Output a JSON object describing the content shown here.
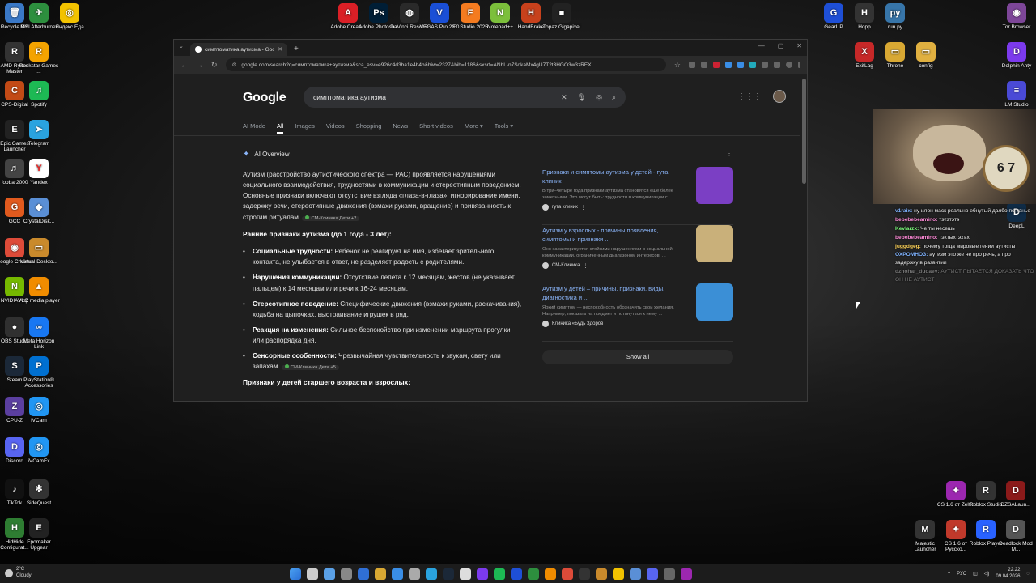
{
  "desktop": {
    "icons_left": [
      {
        "label": "Recycle Bin",
        "color": "#3a78c6",
        "glyph": "🗑"
      },
      {
        "label": "MSI Afterburner",
        "color": "#2d8f3e",
        "glyph": "✈"
      },
      {
        "label": "Яндекс.Еда",
        "color": "#f2c200",
        "glyph": "◎"
      },
      {
        "label": "AMD Ryzen Master",
        "color": "#333333",
        "glyph": "R"
      },
      {
        "label": "Rockstar Games ...",
        "color": "#f4a300",
        "glyph": "R"
      },
      {
        "label": "CPS-Digital",
        "color": "#c24a16",
        "glyph": "C"
      },
      {
        "label": "Spotify",
        "color": "#1db954",
        "glyph": "♫"
      },
      {
        "label": "Epic Games Launcher",
        "color": "#222222",
        "glyph": "E"
      },
      {
        "label": "Telegram",
        "color": "#2aa3df",
        "glyph": "➤"
      },
      {
        "label": "foobar2000",
        "color": "#444444",
        "glyph": "♬"
      },
      {
        "label": "Yandex",
        "color": "#ffffff",
        "glyph": "Y"
      },
      {
        "label": "GCC",
        "color": "#e15a1e",
        "glyph": "G"
      },
      {
        "label": "CrystalDisk...",
        "color": "#5a8fd6",
        "glyph": "◆"
      },
      {
        "label": "Google Chrome",
        "color": "#dd4b39",
        "glyph": "◉"
      },
      {
        "label": "Virtual Deskto...",
        "color": "#c98a2c",
        "glyph": "▭"
      },
      {
        "label": "NVIDIA App",
        "color": "#76b900",
        "glyph": "N"
      },
      {
        "label": "VLC media player",
        "color": "#f08c00",
        "glyph": "▲"
      },
      {
        "label": "OBS Studio",
        "color": "#303030",
        "glyph": "●"
      },
      {
        "label": "Meta Horizon Link",
        "color": "#1877f2",
        "glyph": "∞"
      },
      {
        "label": "Steam",
        "color": "#1b2838",
        "glyph": "S"
      },
      {
        "label": "PlayStation® Accessories",
        "color": "#0070d1",
        "glyph": "P"
      },
      {
        "label": "CPU-Z",
        "color": "#5b3fa0",
        "glyph": "Z"
      },
      {
        "label": "iVCam",
        "color": "#2196f3",
        "glyph": "◎"
      },
      {
        "label": "Discord",
        "color": "#5865f2",
        "glyph": "D"
      },
      {
        "label": "iVCamEx",
        "color": "#2196f3",
        "glyph": "◎"
      },
      {
        "label": "TikTok",
        "color": "#111111",
        "glyph": "♪"
      },
      {
        "label": "SideQuest",
        "color": "#333333",
        "glyph": "✻"
      },
      {
        "label": "HidHide Configurat...",
        "color": "#2e7d32",
        "glyph": "H"
      },
      {
        "label": "Epomaker Upgear",
        "color": "#222222",
        "glyph": "E"
      }
    ],
    "icons_top": [
      {
        "label": "Adobe Creati...",
        "color": "#da1f26",
        "glyph": "A"
      },
      {
        "label": "Adobe Photosh...",
        "color": "#001e36",
        "glyph": "Ps"
      },
      {
        "label": "DaVinci Resolve",
        "color": "#2a2a2a",
        "glyph": "◍"
      },
      {
        "label": "VEGAS Pro 23.0",
        "color": "#1a4fd6",
        "glyph": "V"
      },
      {
        "label": "FL Studio 2025",
        "color": "#f47b20",
        "glyph": "F"
      },
      {
        "label": "Notepad++",
        "color": "#7cbf3b",
        "glyph": "N"
      },
      {
        "label": "HandBrake",
        "color": "#c7411c",
        "glyph": "H"
      },
      {
        "label": "Topaz Gigapixel",
        "color": "#222222",
        "glyph": "■"
      }
    ],
    "icons_right": [
      {
        "label": "GearUP",
        "color": "#1e4fd6",
        "glyph": "G"
      },
      {
        "label": "Hopp",
        "color": "#333333",
        "glyph": "H"
      },
      {
        "label": "run.py",
        "color": "#3775a9",
        "glyph": "py"
      },
      {
        "label": "Tor Browser",
        "color": "#7d4698",
        "glyph": "◉"
      },
      {
        "label": "ExitLag",
        "color": "#c62828",
        "glyph": "X"
      },
      {
        "label": "Throne",
        "color": "#d8a833",
        "glyph": "▭"
      },
      {
        "label": "config",
        "color": "#e0b040",
        "glyph": "▭"
      },
      {
        "label": "Dolphin Anty",
        "color": "#7c3aed",
        "glyph": "D"
      },
      {
        "label": "LM Studio",
        "color": "#4a4ad6",
        "glyph": "≡"
      },
      {
        "label": "DeepL",
        "color": "#0f2b46",
        "glyph": "D"
      },
      {
        "label": "CS 1.6 от Zeltto",
        "color": "#9c27b0",
        "glyph": "✦"
      },
      {
        "label": "Roblox Studio",
        "color": "#333333",
        "glyph": "R"
      },
      {
        "label": "DZSALaun...",
        "color": "#8b1a1a",
        "glyph": "D"
      },
      {
        "label": "Majestic Launcher",
        "color": "#333333",
        "glyph": "M"
      },
      {
        "label": "CS 1.6 от Русско...",
        "color": "#c0392b",
        "glyph": "✦"
      },
      {
        "label": "Roblox Player",
        "color": "#2962ff",
        "glyph": "R"
      },
      {
        "label": "Deadlock Mod M...",
        "color": "#555555",
        "glyph": "D"
      }
    ]
  },
  "browser": {
    "tab_title": "симптоматика аутизма - Google",
    "url": "google.com/search?q=симптоматика+аутизма&sca_esv=e926c4d3ba1e4b4b&biw=2327&bih=1186&sxsrf=ANbL-n7SdkaMx4gU7T2t3HGO3w3zREX...",
    "search_query": "симптоматика аутизма",
    "logo": "Google",
    "filters": [
      "AI Mode",
      "All",
      "Images",
      "Videos",
      "Shopping",
      "News",
      "Short videos",
      "More ▾",
      "Tools ▾"
    ],
    "ai_overview_label": "AI Overview",
    "intro": "Аутизм (расстройство аутистического спектра — РАС) проявляется нарушениями социального взаимодействия, трудностями в коммуникации и стереотипным поведением. Основные признаки включают отсутствие взгляда «глаза-в-глаза», игнорирование имени, задержку речи, стереотипные движения (взмахи руками, вращение) и привязанность к строгим ритуалам.",
    "intro_chip": "СМ-Клиника  Дети +2",
    "early_heading": "Ранние признаки аутизма (до 1 года - 3 лет):",
    "early_items": [
      {
        "bold": "Социальные трудности:",
        "text": " Ребенок не реагирует на имя, избегает зрительного контакта, не улыбается в ответ, не разделяет радость с родителями."
      },
      {
        "bold": "Нарушения коммуникации:",
        "text": " Отсутствие лепета к 12 месяцам, жестов (не указывает пальцем) к 14 месяцам или речи к 16-24 месяцам."
      },
      {
        "bold": "Стереотипное поведение:",
        "text": " Специфические движения (взмахи руками, раскачивания), ходьба на цыпочках, выстраивание игрушек в ряд."
      },
      {
        "bold": "Реакция на изменения:",
        "text": " Сильное беспокойство при изменении маршрута прогулки или распорядка дня."
      },
      {
        "bold": "Сенсорные особенности:",
        "text": " Чрезвычайная чувствительность к звукам, свету или запахам."
      }
    ],
    "sensor_chip": "СМ-Клиника  Дети +5",
    "older_heading": "Признаки у детей старшего возраста и взрослых:",
    "sources": [
      {
        "title": "Признаки и симптомы аутизма у детей - гута клиник",
        "snippet": "В три–четыре года признаки аутизма становятся еще более заметными. Это могут быть: трудности в коммуникации с ...",
        "source": "гута клиник",
        "thumb": "#7b3fc4"
      },
      {
        "title": "Аутизм у взрослых - причины появления, симптомы и признаки ...",
        "snippet": "Оно характеризуется стойкими нарушениями в социальной коммуникации, ограниченным диапазоном интересов, ...",
        "source": "СМ-Клиника",
        "thumb": "#c9b07a"
      },
      {
        "title": "Аутизм у детей – причины, признаки, виды, диагностика и ...",
        "snippet": "Яркий симптом — неспособность обозначить свои желания. Например, показать на предмет и потянуться к нему ...",
        "source": "Клиника «Будь Здоров",
        "thumb": "#3b8fd6"
      }
    ],
    "show_all": "Show all"
  },
  "stream": {
    "clock_text": "6 7"
  },
  "chat": [
    {
      "user": "v1raix:",
      "color": "#7fb3ff",
      "text": " ну илон маск реально ебнутый далбо по канье"
    },
    {
      "user": "bebebebeamino:",
      "color": "#ff8ad8",
      "text": " тэтэтэтэ"
    },
    {
      "user": "Kevlarzx:",
      "color": "#7cff7c",
      "text": " Че ты несешь"
    },
    {
      "user": "bebebebeamino:",
      "color": "#ff8ad8",
      "text": " тэхтыхтэхъх"
    },
    {
      "user": "juggdgeg:",
      "color": "#ffd45a",
      "text": " почему тогда мировые гении аутисты"
    },
    {
      "user": "ОХРОМНОЗ:",
      "color": "#7fb3ff",
      "text": " аутизм это же не про речь, а про задержку в развитии"
    },
    {
      "user": "dzhohar_dudaev:",
      "color": "#777777",
      "text": " АУТИСТ ПЫТАЕТСЯ ДОКАЗАТЬ ЧТО ОН НЕ АУТИСТ",
      "faded": true
    }
  ],
  "taskbar": {
    "weather_temp": "2°C",
    "weather_desc": "Cloudy",
    "lang": "РУС",
    "time": "22:22",
    "date": "09.04.2026",
    "pinned_colors": [
      "#3a8ee6",
      "#cccccc",
      "#5aa0e6",
      "#888888",
      "#2f6fd6",
      "#d8a833",
      "#3a8ee6",
      "#aaaaaa",
      "#2aa3df",
      "#1b2838",
      "#dddddd",
      "#7c3aed",
      "#1db954",
      "#1e4fd6",
      "#2d8f3e",
      "#f08c00",
      "#dd4b39",
      "#333333",
      "#c98a2c",
      "#f2c200",
      "#5a8fd6",
      "#5865f2",
      "#666666",
      "#9c27b0"
    ]
  }
}
